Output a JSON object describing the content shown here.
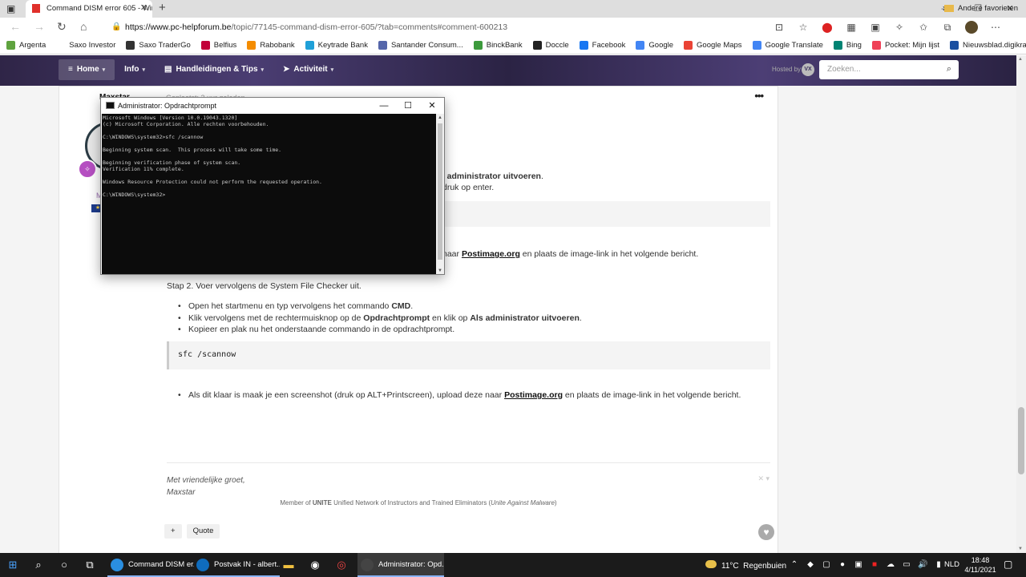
{
  "browser": {
    "tab_title": "Command DISM error 605 - Wind",
    "url_domain": "https://www.pc-helpforum.be",
    "url_path": "/topic/77145-command-dism-error-605/?tab=comments#comment-600213",
    "profile_badge": "12",
    "bookmarks": [
      {
        "label": "Argenta",
        "color": "#5fa33f"
      },
      {
        "label": "Saxo Investor",
        "color": "#ffffff"
      },
      {
        "label": "Saxo TraderGo",
        "color": "#333333"
      },
      {
        "label": "Belfius",
        "color": "#c2003a"
      },
      {
        "label": "Rabobank",
        "color": "#f48c00"
      },
      {
        "label": "Keytrade Bank",
        "color": "#1fa0d8"
      },
      {
        "label": "Santander Consum...",
        "color": "#5566aa"
      },
      {
        "label": "BinckBank",
        "color": "#3c9a3c"
      },
      {
        "label": "Doccle",
        "color": "#222222"
      },
      {
        "label": "Facebook",
        "color": "#1877f2"
      },
      {
        "label": "Google",
        "color": "#4285f4"
      },
      {
        "label": "Google Maps",
        "color": "#ea4335"
      },
      {
        "label": "Google Translate",
        "color": "#4285f4"
      },
      {
        "label": "Bing",
        "color": "#008373"
      },
      {
        "label": "Pocket: Mijn lijst",
        "color": "#ef4056"
      },
      {
        "label": "Nieuwsblad.digikrant",
        "color": "#1a4fa0"
      }
    ],
    "other_bookmarks": "Andere favorieten"
  },
  "forum": {
    "nav": [
      {
        "label": "Home",
        "icon": "≡",
        "caret": "▾"
      },
      {
        "label": "Info",
        "icon": "",
        "caret": "▾"
      },
      {
        "label": "Handleidingen & Tips",
        "icon": "▤",
        "caret": "▾"
      },
      {
        "label": "Activiteit",
        "icon": "➤",
        "caret": "▾"
      }
    ],
    "powered_by": "Hosted by",
    "search_placeholder": "Zoeken...",
    "post": {
      "author": "Maxstar",
      "posted": "Geplaatst: 2 uur geleden",
      "top_frag1_pre": "ls administrator uitvoeren",
      "top_frag1_post": ".",
      "top_frag2": "druk op enter.",
      "top_frag3_pre": "naar ",
      "top_frag3_link": "Postimage.org",
      "top_frag3_post": " en plaats de image-link in het volgende bericht.",
      "step2": "Stap 2. Voer vervolgens de System File Checker uit.",
      "b1_pre": "Open het startmenu en typ vervolgens het commando ",
      "b1_bold": "CMD",
      "b1_post": ".",
      "b2_pre": "Klik vervolgens met de rechtermuisknop op de ",
      "b2_bold1": "Opdrachtprompt",
      "b2_mid": " en klik op ",
      "b2_bold2": "Als administrator uitvoeren",
      "b2_post": ".",
      "b3": "Kopieer en plak nu het onderstaande commando in de opdrachtprompt.",
      "code": "sfc /scannow",
      "b4_pre": "Als dit klaar is maak je een screenshot (druk op ALT+Printscreen), upload deze naar ",
      "b4_link": "Postimage.org",
      "b4_post": " en plaats de image-link in het volgende bericht.",
      "sig1": "Met vriendelijke groet,",
      "sig2": "Maxstar",
      "member_pre": "Member of ",
      "member_bold": "UNITE",
      "member_mid": " Unified Network of Instructors and Trained Eliminators (",
      "member_it": "Unite Against Malware",
      "member_post": ")",
      "plus": "+",
      "quote": "Quote",
      "m_char": "M"
    }
  },
  "cmd": {
    "title": "Administrator: Opdrachtprompt",
    "lines": "Microsoft Windows [Version 10.0.19043.1320]\n(c) Microsoft Corporation. Alle rechten voorbehouden.\n\nC:\\WINDOWS\\system32>sfc /scannow\n\nBeginning system scan.  This process will take some time.\n\nBeginning verification phase of system scan.\nVerification 11% complete.\n\nWindows Resource Protection could not perform the requested operation.\n\nC:\\WINDOWS\\system32>"
  },
  "taskbar": {
    "items": [
      {
        "label": "Command DISM er...",
        "color": "#2a8ee0"
      },
      {
        "label": "Postvak IN - albert....",
        "color": "#0f6cbd"
      },
      {
        "label": "Administrator: Opd...",
        "color": "#444444"
      }
    ],
    "weather_temp": "11°C",
    "weather_text": "Regenbuien",
    "lang": "NLD",
    "time": "18:48",
    "date": "4/11/2021"
  }
}
